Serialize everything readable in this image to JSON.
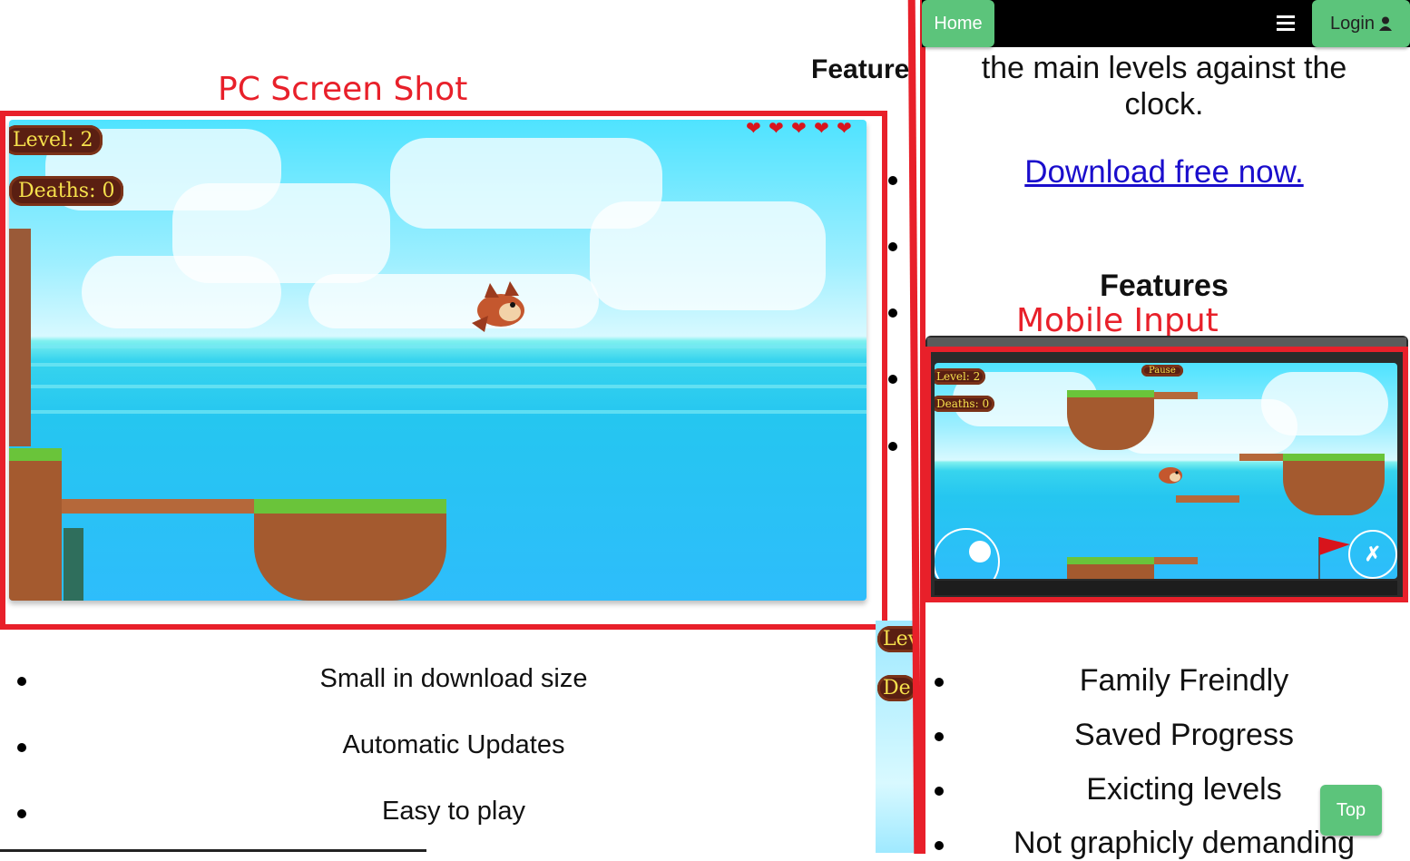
{
  "pc": {
    "caption": "PC Screen Shot",
    "feature_heading_cut": "Feature",
    "hud": {
      "level": "Level: 2",
      "deaths": "Deaths: 0",
      "hearts": 5
    },
    "list": [
      "Small in download size",
      "Automatic Updates",
      "Easy to play"
    ]
  },
  "middle_strip": {
    "level_cut": "Lev",
    "deaths_cut": "De"
  },
  "mobile": {
    "nav": {
      "home_label": "Home",
      "login_label": "Login",
      "menu_icon": "hamburger-icon",
      "user_icon": "user-icon"
    },
    "intro_text": "the main levels against the clock.",
    "download_link": "Download free now.",
    "features_heading": "Features",
    "caption": "Mobile Input",
    "hud": {
      "level": "Level: 2",
      "deaths": "Deaths: 0",
      "pause": "Pause"
    },
    "list": [
      "Family Freindly",
      "Saved Progress",
      "Exicting levels",
      "Not graphicly demanding"
    ],
    "top_button": "Top"
  },
  "colors": {
    "accent_red": "#e8202a",
    "button_green": "#5cc47b",
    "link_blue": "#1a0dcc",
    "navbar": "#000000"
  }
}
